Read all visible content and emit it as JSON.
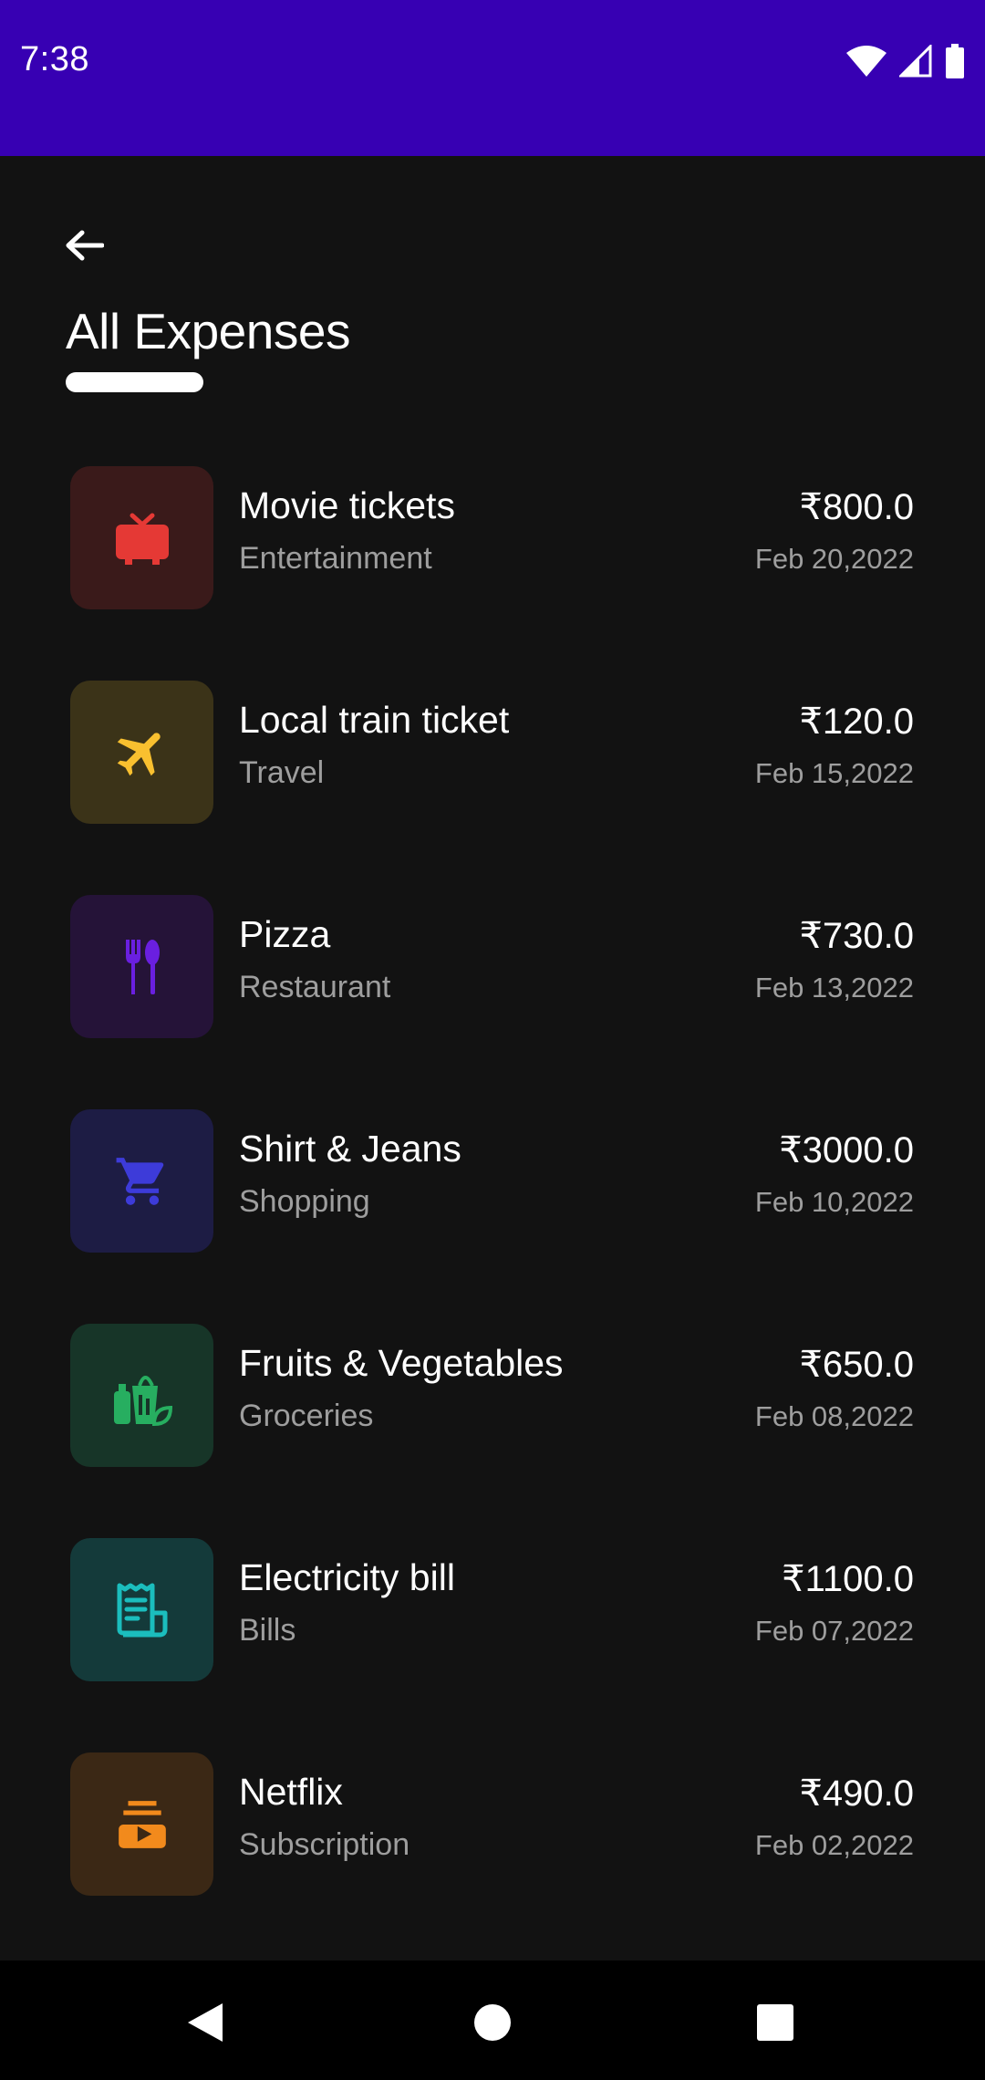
{
  "status_bar": {
    "time": "7:38"
  },
  "header": {
    "title": "All Expenses"
  },
  "expenses": [
    {
      "name": "Movie tickets",
      "category": "Entertainment",
      "amount": "₹800.0",
      "date": "Feb 20,2022",
      "icon": "tv-icon",
      "tile_color": "#3a1a1a",
      "icon_color": "#e53935"
    },
    {
      "name": "Local train ticket",
      "category": "Travel",
      "amount": "₹120.0",
      "date": "Feb 15,2022",
      "icon": "airplane-icon",
      "tile_color": "#3b3318",
      "icon_color": "#f9c02f"
    },
    {
      "name": "Pizza",
      "category": "Restaurant",
      "amount": "₹730.0",
      "date": "Feb 13,2022",
      "icon": "fork-spoon-icon",
      "tile_color": "#251338",
      "icon_color": "#6a1fe0"
    },
    {
      "name": "Shirt & Jeans",
      "category": "Shopping",
      "amount": "₹3000.0",
      "date": "Feb 10,2022",
      "icon": "cart-icon",
      "tile_color": "#1d1c44",
      "icon_color": "#3d3bd9"
    },
    {
      "name": "Fruits & Vegetables",
      "category": "Groceries",
      "amount": "₹650.0",
      "date": "Feb 08,2022",
      "icon": "groceries-icon",
      "tile_color": "#173528",
      "icon_color": "#27ae60"
    },
    {
      "name": "Electricity bill",
      "category": "Bills",
      "amount": "₹1100.0",
      "date": "Feb 07,2022",
      "icon": "receipt-icon",
      "tile_color": "#143a3a",
      "icon_color": "#1bbdbd"
    },
    {
      "name": "Netflix",
      "category": "Subscription",
      "amount": "₹490.0",
      "date": "Feb 02,2022",
      "icon": "subscriptions-icon",
      "tile_color": "#3b2815",
      "icon_color": "#f28a1c"
    }
  ]
}
